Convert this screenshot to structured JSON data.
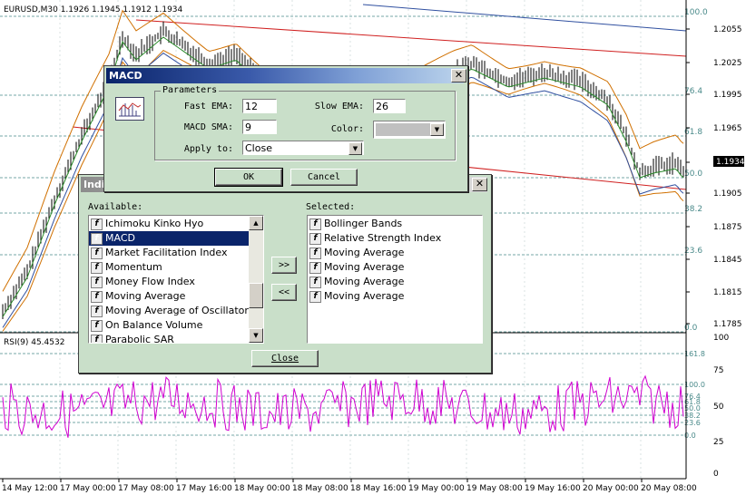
{
  "chart": {
    "symbol_info": "EURUSD,M30  1.1926 1.1945 1.1912 1.1934",
    "price_ticks": [
      "1.2055",
      "1.2025",
      "1.1995",
      "1.1965",
      "1.1934",
      "1.1905",
      "1.1875",
      "1.1845",
      "1.1815",
      "1.1785"
    ],
    "fib_levels": [
      "100.0",
      "76.4",
      "61.8",
      "50.0",
      "38.2",
      "23.6",
      "0.0"
    ],
    "current_price": "1.1934",
    "rsi_label": "RSI(9)  45.4532",
    "rsi_ticks": [
      "100",
      "75",
      "50",
      "25",
      "0"
    ],
    "rsi_fib_levels": [
      "161.8",
      "100.0",
      "76.4",
      "61.8",
      "50.0",
      "38.2",
      "23.6",
      "0.0"
    ],
    "time_ticks": [
      "14 May 12:00",
      "17 May 00:00",
      "17 May 08:00",
      "17 May 16:00",
      "18 May 00:00",
      "18 May 08:00",
      "18 May 16:00",
      "19 May 00:00",
      "19 May 08:00",
      "19 May 16:00",
      "20 May 00:00",
      "20 May 08:00"
    ],
    "colors": {
      "grid": "#4a8a8a",
      "price": "#000000",
      "rsi": "#d000d0",
      "red_line": "#d02020",
      "blue_line": "#3050a0",
      "orange": "#d07000",
      "green": "#2a8a2a"
    }
  },
  "indicators_dialog": {
    "title": "Indicators",
    "available_label": "Available:",
    "selected_label": "Selected:",
    "available": [
      "Ichimoku Kinko Hyo",
      "MACD",
      "Market Facilitation Index",
      "Momentum",
      "Money Flow Index",
      "Moving Average",
      "Moving Average of Oscillator",
      "On Balance Volume",
      "Parabolic SAR"
    ],
    "selected_index": 1,
    "selected": [
      "Bollinger Bands",
      "Relative Strength Index",
      "Moving Average",
      "Moving Average",
      "Moving Average",
      "Moving Average"
    ],
    "add_button": ">>",
    "remove_button": "<<",
    "close_button": "Close"
  },
  "macd_dialog": {
    "title": "MACD",
    "group_label": "Parameters",
    "fast_ema_label": "Fast EMA:",
    "fast_ema_value": "12",
    "slow_ema_label": "Slow EMA:",
    "slow_ema_value": "26",
    "macd_sma_label": "MACD SMA:",
    "macd_sma_value": "9",
    "color_label": "Color:",
    "color_value": "#c0c0c0",
    "apply_to_label": "Apply to:",
    "apply_to_value": "Close",
    "ok_button": "OK",
    "cancel_button": "Cancel"
  }
}
